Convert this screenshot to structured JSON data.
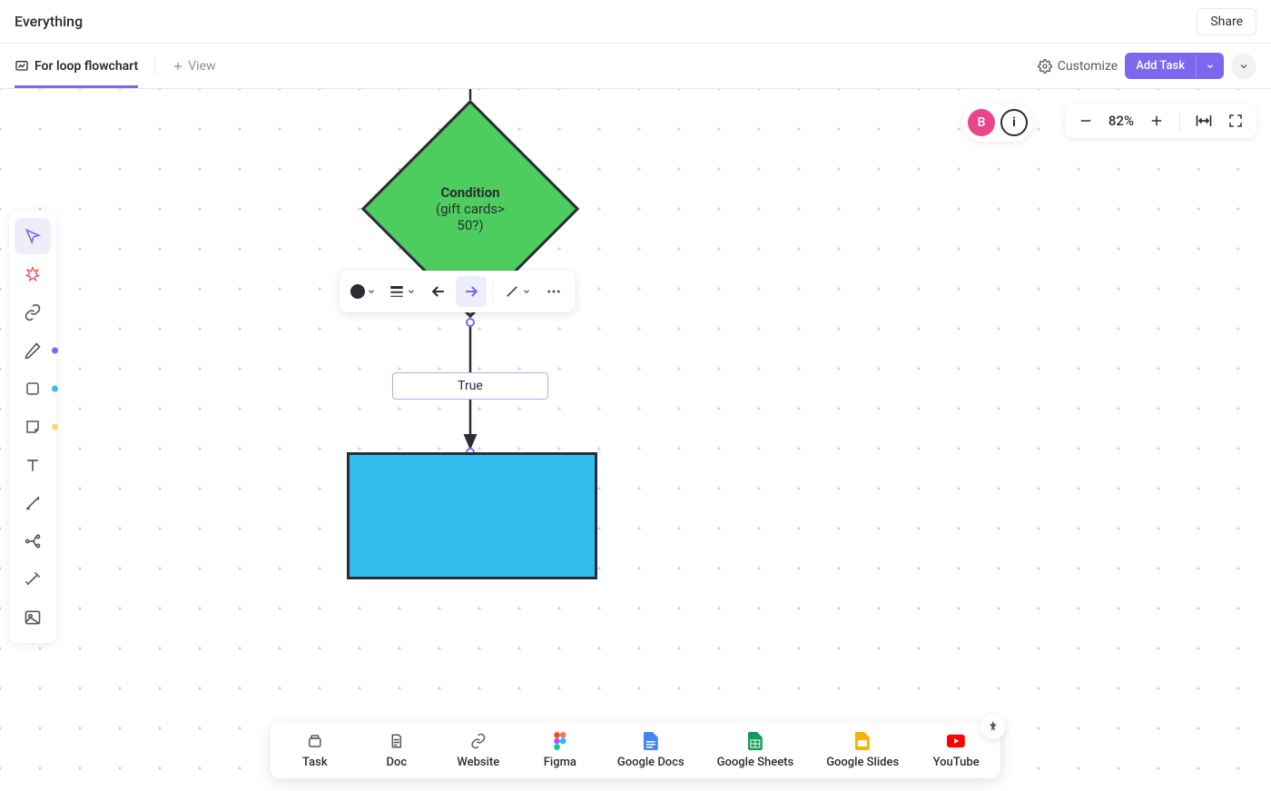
{
  "header": {
    "title": "Everything",
    "share_label": "Share"
  },
  "tabs": {
    "active_label": "For loop flowchart",
    "add_view_label": "View",
    "customize_label": "Customize",
    "add_task_label": "Add Task"
  },
  "zoom": {
    "percent": "82%"
  },
  "avatar_letter": "B",
  "toolbar": {
    "items": [
      {
        "name": "select-tool",
        "active": true,
        "dot": null
      },
      {
        "name": "ai-tool",
        "active": false,
        "dot": null
      },
      {
        "name": "link-tool",
        "active": false,
        "dot": null
      },
      {
        "name": "pen-tool",
        "active": false,
        "dot": "#7b68ee"
      },
      {
        "name": "shape-tool",
        "active": false,
        "dot": "#33bef0"
      },
      {
        "name": "sticky-tool",
        "active": false,
        "dot": "#f9d978"
      },
      {
        "name": "text-tool",
        "active": false,
        "dot": null
      },
      {
        "name": "connector-tool",
        "active": false,
        "dot": null
      },
      {
        "name": "mindmap-tool",
        "active": false,
        "dot": null
      },
      {
        "name": "effects-tool",
        "active": false,
        "dot": null
      },
      {
        "name": "image-tool",
        "active": false,
        "dot": null
      }
    ]
  },
  "diamond": {
    "title": "Condition",
    "line1": "(gift cards>",
    "line2": "50?)"
  },
  "edge_label": "True",
  "dock": [
    {
      "name": "task",
      "label": "Task"
    },
    {
      "name": "doc",
      "label": "Doc"
    },
    {
      "name": "website",
      "label": "Website"
    },
    {
      "name": "figma",
      "label": "Figma"
    },
    {
      "name": "gdocs",
      "label": "Google Docs"
    },
    {
      "name": "gsheets",
      "label": "Google Sheets"
    },
    {
      "name": "gslides",
      "label": "Google Slides"
    },
    {
      "name": "youtube",
      "label": "YouTube"
    }
  ]
}
